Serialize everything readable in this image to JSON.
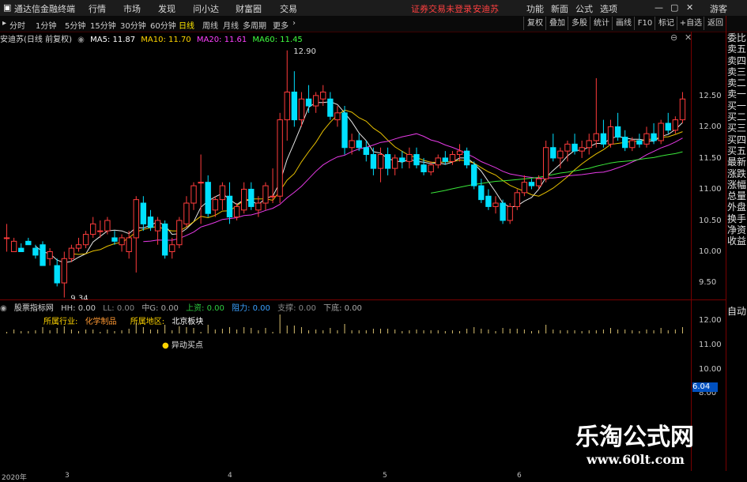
{
  "app": {
    "title": "通达信金融终端",
    "menu": [
      "行情",
      "市场",
      "发现",
      "问小达",
      "财富圈",
      "交易"
    ],
    "login_notice": "证券交易未登录",
    "stock_name": "安迪苏",
    "right_menu": [
      "功能",
      "新面",
      "公式",
      "选项"
    ],
    "guest": "游客"
  },
  "toolbar": {
    "periods": [
      "分时",
      "1分钟",
      "5分钟",
      "15分钟",
      "30分钟",
      "60分钟",
      "日线",
      "周线",
      "月线",
      "多周期",
      "更多"
    ],
    "active_period": "日线",
    "buttons": [
      "复权",
      "叠加",
      "多股",
      "统计",
      "画线",
      "F10",
      "标记",
      "+自选",
      "返回"
    ]
  },
  "info": {
    "title": "安迪苏(日线 前复权)",
    "ma5": "MA5: 11.87",
    "ma10": "MA10: 11.70",
    "ma20": "MA20: 11.61",
    "ma60": "MA60: 11.45"
  },
  "right_list": [
    "委比",
    "卖五",
    "卖四",
    "卖三",
    "卖二",
    "卖一",
    "买一",
    "买二",
    "买三",
    "买四",
    "买五",
    "最新",
    "涨跌",
    "涨幅",
    "总量",
    "外盘",
    "换手",
    "净资",
    "收益"
  ],
  "right_auto": "自动",
  "sub": {
    "name": "股票指标网",
    "hh": "HH: 0.00",
    "ll": "LL: 0.00",
    "zg": "中G: 0.00",
    "up": "上资: 0.00",
    "zl": "阻力: 0.00",
    "zc": "支撑: 0.00",
    "xd": "下底: 0.00",
    "industry_label": "所属行业:",
    "industry_value": "化学制品",
    "region_label": "所属地区:",
    "region_value": "北京板块",
    "alert": "异动买点",
    "badge": "6.04"
  },
  "watermark": {
    "line1": "乐淘公式网",
    "line2": "www.60lt.com"
  },
  "bottom_axis": {
    "year": "2020年",
    "marks": [
      "3",
      "4",
      "5",
      "6"
    ]
  },
  "chart_data": {
    "type": "candlestick",
    "y_axis_labels": [
      "12.50",
      "12.00",
      "11.50",
      "11.00",
      "10.50",
      "10.00",
      "9.50"
    ],
    "sub_y_axis_labels": [
      "12.00",
      "11.00",
      "10.00",
      "9.00",
      "8.00"
    ],
    "high_label": "12.90",
    "low_label": "9.34",
    "ylim": [
      9.3,
      13.0
    ],
    "colors": {
      "up": "#ff3c3c",
      "down": "#00e0ff",
      "ma5": "#ffffff",
      "ma10": "#ffd400",
      "ma20": "#ff40ff",
      "ma60": "#40ff40"
    },
    "candles": [
      [
        10.2,
        10.4,
        10.0,
        10.2
      ],
      [
        10.0,
        10.2,
        10.0,
        10.15
      ],
      [
        10.05,
        10.12,
        10.0,
        10.0
      ],
      [
        10.15,
        10.2,
        10.1,
        10.1
      ],
      [
        10.05,
        10.1,
        9.9,
        9.95
      ],
      [
        10.1,
        10.15,
        9.8,
        9.8
      ],
      [
        9.9,
        10.05,
        9.8,
        10.0
      ],
      [
        9.8,
        9.9,
        9.5,
        9.55
      ],
      [
        9.55,
        10.0,
        9.34,
        9.9
      ],
      [
        9.9,
        10.1,
        9.85,
        10.05
      ],
      [
        10.05,
        10.2,
        10.0,
        10.1
      ],
      [
        10.1,
        10.3,
        10.05,
        10.25
      ],
      [
        10.25,
        10.5,
        10.2,
        10.4
      ],
      [
        10.3,
        10.45,
        10.2,
        10.3
      ],
      [
        10.3,
        10.5,
        10.25,
        10.45
      ],
      [
        10.2,
        10.3,
        10.1,
        10.15
      ],
      [
        10.1,
        10.25,
        10.0,
        10.2
      ],
      [
        10.0,
        10.3,
        9.9,
        10.2
      ],
      [
        10.2,
        10.8,
        9.7,
        10.75
      ],
      [
        10.7,
        10.8,
        10.3,
        10.4
      ],
      [
        10.5,
        10.6,
        10.3,
        10.35
      ],
      [
        10.3,
        10.5,
        10.1,
        10.45
      ],
      [
        10.4,
        10.45,
        9.9,
        9.95
      ],
      [
        10.0,
        10.2,
        9.9,
        10.1
      ],
      [
        10.1,
        10.5,
        10.05,
        10.45
      ],
      [
        10.4,
        10.8,
        10.35,
        10.7
      ],
      [
        10.7,
        11.0,
        10.6,
        10.95
      ],
      [
        11.0,
        11.4,
        10.4,
        11.0
      ],
      [
        11.0,
        11.1,
        10.5,
        10.55
      ],
      [
        10.6,
        10.8,
        10.5,
        10.75
      ],
      [
        10.75,
        11.0,
        10.6,
        10.95
      ],
      [
        10.8,
        11.0,
        10.4,
        10.5
      ],
      [
        10.5,
        10.7,
        10.45,
        10.65
      ],
      [
        10.6,
        11.0,
        10.55,
        10.9
      ],
      [
        10.9,
        11.0,
        10.6,
        10.65
      ],
      [
        10.6,
        10.8,
        10.5,
        10.7
      ],
      [
        10.7,
        11.0,
        10.6,
        10.95
      ],
      [
        10.8,
        11.2,
        10.7,
        10.8
      ],
      [
        10.8,
        12.0,
        10.7,
        11.9
      ],
      [
        11.9,
        12.9,
        11.6,
        12.3
      ],
      [
        12.3,
        12.6,
        11.8,
        11.9
      ],
      [
        11.9,
        12.3,
        11.8,
        12.2
      ],
      [
        12.2,
        12.4,
        12.0,
        12.1
      ],
      [
        12.1,
        12.3,
        12.0,
        12.25
      ],
      [
        12.2,
        12.4,
        12.1,
        12.3
      ],
      [
        12.2,
        12.3,
        11.9,
        11.95
      ],
      [
        11.9,
        12.1,
        11.8,
        12.0
      ],
      [
        12.0,
        12.1,
        11.4,
        11.5
      ],
      [
        11.5,
        11.7,
        11.4,
        11.6
      ],
      [
        11.6,
        11.7,
        11.45,
        11.5
      ],
      [
        11.5,
        11.6,
        11.3,
        11.4
      ],
      [
        11.4,
        11.5,
        11.1,
        11.2
      ],
      [
        11.2,
        11.5,
        11.0,
        11.4
      ],
      [
        11.4,
        11.5,
        11.1,
        11.2
      ],
      [
        11.2,
        11.4,
        11.1,
        11.35
      ],
      [
        11.35,
        11.45,
        11.2,
        11.3
      ],
      [
        11.3,
        11.5,
        11.2,
        11.4
      ],
      [
        11.4,
        11.5,
        11.2,
        11.25
      ],
      [
        11.25,
        11.35,
        11.1,
        11.15
      ],
      [
        11.15,
        11.3,
        11.1,
        11.25
      ],
      [
        11.25,
        11.4,
        11.2,
        11.35
      ],
      [
        11.35,
        11.45,
        11.25,
        11.3
      ],
      [
        11.3,
        11.45,
        11.25,
        11.4
      ],
      [
        11.4,
        11.55,
        11.3,
        11.45
      ],
      [
        11.45,
        11.5,
        11.2,
        11.25
      ],
      [
        11.25,
        11.3,
        10.9,
        10.95
      ],
      [
        10.95,
        11.05,
        10.7,
        10.75
      ],
      [
        10.8,
        10.9,
        10.6,
        10.65
      ],
      [
        10.65,
        10.8,
        10.55,
        10.7
      ],
      [
        10.7,
        10.75,
        10.4,
        10.45
      ],
      [
        10.45,
        10.7,
        10.4,
        10.65
      ],
      [
        10.65,
        10.9,
        10.6,
        10.85
      ],
      [
        10.85,
        11.1,
        10.8,
        11.0
      ],
      [
        11.0,
        11.05,
        10.9,
        10.95
      ],
      [
        10.95,
        11.1,
        10.9,
        11.05
      ],
      [
        11.05,
        11.6,
        11.0,
        11.5
      ],
      [
        11.5,
        11.7,
        11.3,
        11.35
      ],
      [
        11.35,
        11.5,
        11.2,
        11.45
      ],
      [
        11.45,
        11.6,
        11.3,
        11.55
      ],
      [
        11.55,
        11.7,
        11.4,
        11.45
      ],
      [
        11.45,
        11.6,
        11.35,
        11.5
      ],
      [
        11.5,
        11.7,
        11.4,
        11.6
      ],
      [
        11.6,
        12.5,
        11.5,
        11.7
      ],
      [
        11.7,
        11.9,
        11.5,
        11.55
      ],
      [
        11.55,
        11.9,
        11.5,
        11.8
      ],
      [
        11.8,
        12.0,
        11.6,
        11.65
      ],
      [
        11.65,
        11.75,
        11.45,
        11.5
      ],
      [
        11.5,
        11.65,
        11.45,
        11.6
      ],
      [
        11.6,
        11.7,
        11.5,
        11.55
      ],
      [
        11.55,
        11.8,
        11.5,
        11.7
      ],
      [
        11.7,
        11.85,
        11.55,
        11.6
      ],
      [
        11.6,
        11.9,
        11.55,
        11.85
      ],
      [
        11.85,
        12.0,
        11.7,
        11.75
      ],
      [
        11.75,
        11.95,
        11.7,
        11.9
      ],
      [
        11.9,
        12.3,
        11.85,
        12.2
      ]
    ]
  }
}
